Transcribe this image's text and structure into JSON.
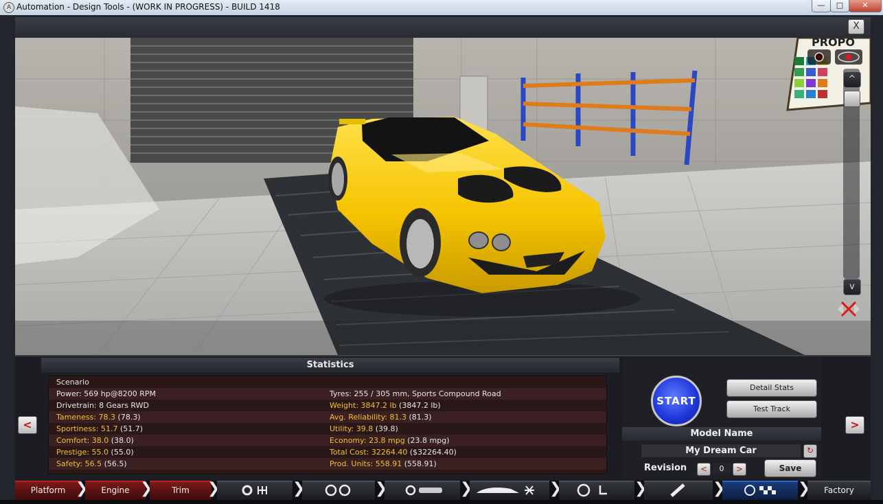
{
  "window": {
    "title": "Automation - Design Tools - (WORK IN PROGRESS) - BUILD 1418",
    "app_icon": "A"
  },
  "window_controls": {
    "minimize": "—",
    "maximize": "□",
    "close": "✕"
  },
  "viewer": {
    "close_label": "X",
    "scroll_up": "^",
    "scroll_down": "v",
    "poster_text": "PROPO"
  },
  "stats": {
    "title": "Statistics",
    "left": [
      {
        "label": "Scenario",
        "value": "",
        "extra": "",
        "highlight": false
      },
      {
        "label": "Power: ",
        "value": "569 hp@8200 RPM",
        "extra": "",
        "highlight": false
      },
      {
        "label": "Drivetrain: ",
        "value": "8 Gears RWD",
        "extra": "",
        "highlight": false
      },
      {
        "label": "Tameness: ",
        "value": "78.3",
        "extra": " (78.3)",
        "highlight": true
      },
      {
        "label": "Sportiness: ",
        "value": "51.7",
        "extra": " (51.7)",
        "highlight": true
      },
      {
        "label": "Comfort: ",
        "value": "38.0",
        "extra": " (38.0)",
        "highlight": true
      },
      {
        "label": "Prestige: ",
        "value": "55.0",
        "extra": " (55.0)",
        "highlight": true
      },
      {
        "label": "Safety: ",
        "value": "56.5",
        "extra": " (56.5)",
        "highlight": true
      }
    ],
    "right": [
      {
        "label": "",
        "value": "",
        "extra": "",
        "highlight": false
      },
      {
        "label": "Tyres: ",
        "value": "255 / 305 mm, Sports Compound Road",
        "extra": "",
        "highlight": false
      },
      {
        "label": "Weight: ",
        "value": "3847.2 lb",
        "extra": " (3847.2 lb)",
        "highlight": true
      },
      {
        "label": "Avg. Reliability: ",
        "value": "81.3",
        "extra": " (81.3)",
        "highlight": true
      },
      {
        "label": "Utility: ",
        "value": "39.8",
        "extra": " (39.8)",
        "highlight": true
      },
      {
        "label": "Economy: ",
        "value": "23.8 mpg",
        "extra": " (23.8 mpg)",
        "highlight": true
      },
      {
        "label": "Total Cost: ",
        "value": "32264.40",
        "extra": " ($32264.40)",
        "highlight": true
      },
      {
        "label": "Prod. Units: ",
        "value": "558.91",
        "extra": " (558.91)",
        "highlight": true
      }
    ]
  },
  "actions": {
    "start": "START",
    "detail_stats": "Detail Stats",
    "test_track": "Test Track",
    "save": "Save"
  },
  "model": {
    "header": "Model Name",
    "name": "My Dream Car",
    "revision_label": "Revision",
    "revision": "0",
    "dec": "<",
    "inc": ">"
  },
  "nav": {
    "prev": "<",
    "next": ">"
  },
  "tabs": {
    "platform": "Platform",
    "engine": "Engine",
    "trim": "Trim",
    "factory": "Factory"
  },
  "colors": {
    "car": "#f5c400",
    "accent_red": "#b32020",
    "accent_blue": "#2a66c8",
    "highlight_text": "#f2c12e"
  }
}
